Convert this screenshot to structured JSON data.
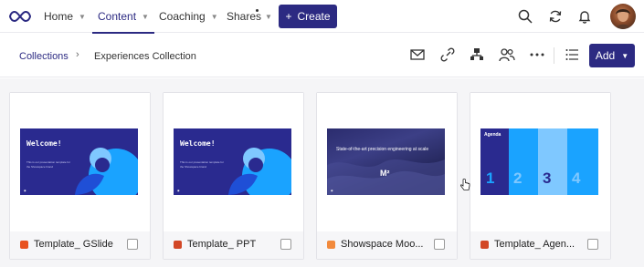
{
  "topnav": {
    "items": [
      {
        "label": "Home",
        "active": false
      },
      {
        "label": "Content",
        "active": true
      },
      {
        "label": "Coaching",
        "active": false
      },
      {
        "label": "Shares",
        "active": false
      }
    ],
    "create_label": "Create",
    "icons": [
      "search-icon",
      "sync-icon",
      "bell-icon",
      "avatar"
    ]
  },
  "breadcrumb": {
    "root": "Collections",
    "current": "Experiences Collection"
  },
  "toolbar": {
    "icons": [
      "mail-icon",
      "link-icon",
      "hierarchy-icon",
      "users-icon",
      "more-icon",
      "list-view-icon"
    ],
    "add_label": "Add"
  },
  "cards": [
    {
      "name": "Template_ GSlide",
      "type": "gslide",
      "icon_color": "#e8521f",
      "thumb": {
        "title": "Welcome!",
        "subtitle": "This is our presentation template for the Showspace brand"
      }
    },
    {
      "name": "Template_ PPT",
      "type": "ppt",
      "icon_color": "#d24726",
      "thumb": {
        "title": "Welcome!",
        "subtitle": "This is our presentation template for the Showspace brand"
      }
    },
    {
      "name": "Showspace Moo...",
      "type": "showspace",
      "icon_color": "#f28a3c",
      "thumb": {
        "title": "State-of-the-art precision engineering at scale",
        "mark": "M²"
      }
    },
    {
      "name": "Template_ Agen...",
      "type": "ppt",
      "icon_color": "#d24726",
      "thumb": {
        "title": "Agenda",
        "numbers": [
          "1",
          "2",
          "3",
          "4"
        ]
      }
    }
  ],
  "colors": {
    "brand": "#2c2a82",
    "thumb_navy": "#2a2a8f",
    "accent_blue": "#1aa3ff",
    "light_blue": "#7fc8ff"
  }
}
